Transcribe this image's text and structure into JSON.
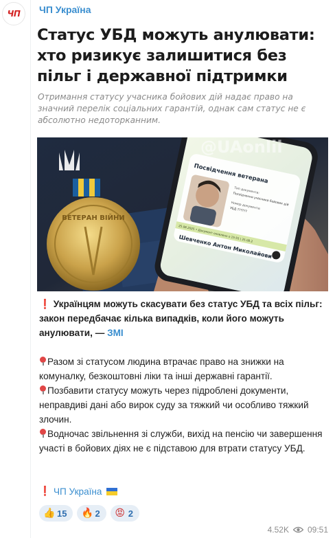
{
  "channel": {
    "avatar_text": "ЧП",
    "name": "ЧП Україна"
  },
  "post": {
    "headline": "Статус УБД можуть анулювати: хто ризикує залишитися без пільг і державної підтримки",
    "subtitle": "Отримання статусу учасника бойових дій надає право на значний перелік соціальних гарантій, однак сам статус не є абсолютно недоторканним.",
    "image": {
      "watermark": "@UAonlii",
      "card_title": "Посвідчення ветерана",
      "card_fields": [
        "Тип документа:",
        "Посвідчення учасника бойових дій",
        "Номер документа:",
        "УБД ??????"
      ],
      "card_date_line": "25.08.2025 • Документ оновлено о 15:55 | 25.08.2",
      "card_name": "Шевченко Антон Миколайович",
      "medal_text": "ВЕТЕРАН ВІЙНИ"
    },
    "lead_mark": "❗",
    "lead_text": "Українцям можуть скасувати без статус УБД та всіх пільг: закон передбачає кілька випадків, коли його можуть анулювати, — ",
    "lead_link": "ЗМІ",
    "points": [
      "Разом зі статусом людина втрачає право на знижки на комуналку, безкоштовні ліки та інші державні гарантії.",
      "Позбавити статусу можуть через підроблені документи, неправдиві дані або вирок суду за тяжкий чи особливо тяжкий злочин.",
      "Водночас звільнення зі служби, вихід на пенсію чи завершення участі в бойових діях не є підставою для втрати статусу УБД."
    ],
    "signature": {
      "mark": "❗",
      "link": "ЧП Україна"
    }
  },
  "reactions": [
    {
      "emoji": "👍",
      "icon": "thumbs-up-icon",
      "count": "15"
    },
    {
      "emoji": "🔥",
      "icon": "fire-icon",
      "count": "2"
    },
    {
      "emoji": "😡",
      "icon": "angry-face-icon",
      "count": "2"
    }
  ],
  "meta": {
    "views": "4.52K",
    "time": "09:51"
  },
  "colors": {
    "link": "#3a8ecf",
    "reaction_bg": "#e6eef6",
    "accent_red": "#d32222"
  }
}
